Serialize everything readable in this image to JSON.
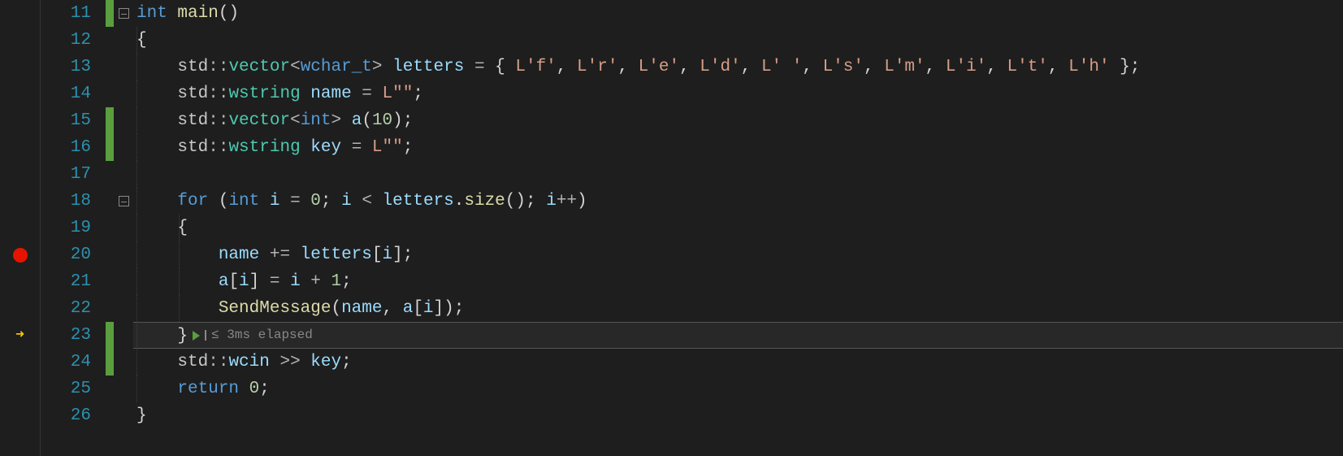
{
  "lines": [
    {
      "n": 11,
      "changed": true,
      "fold": true,
      "bp": false,
      "cur": false
    },
    {
      "n": 12,
      "changed": false,
      "fold": false,
      "bp": false,
      "cur": false
    },
    {
      "n": 13,
      "changed": false,
      "fold": false,
      "bp": false,
      "cur": false
    },
    {
      "n": 14,
      "changed": false,
      "fold": false,
      "bp": false,
      "cur": false
    },
    {
      "n": 15,
      "changed": true,
      "fold": false,
      "bp": false,
      "cur": false
    },
    {
      "n": 16,
      "changed": true,
      "fold": false,
      "bp": false,
      "cur": false
    },
    {
      "n": 17,
      "changed": false,
      "fold": false,
      "bp": false,
      "cur": false
    },
    {
      "n": 18,
      "changed": false,
      "fold": true,
      "bp": false,
      "cur": false
    },
    {
      "n": 19,
      "changed": false,
      "fold": false,
      "bp": false,
      "cur": false
    },
    {
      "n": 20,
      "changed": false,
      "fold": false,
      "bp": true,
      "cur": false
    },
    {
      "n": 21,
      "changed": false,
      "fold": false,
      "bp": false,
      "cur": false
    },
    {
      "n": 22,
      "changed": false,
      "fold": false,
      "bp": false,
      "cur": false
    },
    {
      "n": 23,
      "changed": true,
      "fold": false,
      "bp": false,
      "cur": true
    },
    {
      "n": 24,
      "changed": true,
      "fold": false,
      "bp": false,
      "cur": false
    },
    {
      "n": 25,
      "changed": false,
      "fold": false,
      "bp": false,
      "cur": false
    },
    {
      "n": 26,
      "changed": false,
      "fold": false,
      "bp": false,
      "cur": false
    }
  ],
  "code": {
    "l11": {
      "kw": "int",
      "fn": "main",
      "p": "()"
    },
    "l12": {
      "brace": "{"
    },
    "l13": {
      "ns": "std",
      "sc": "::",
      "cls": "vector",
      "lt": "<",
      "t": "wchar_t",
      "gt": ">",
      "var": "letters",
      "eq": " = ",
      "ob": "{ ",
      "c0": "L'f'",
      "s0": ", ",
      "c1": "L'r'",
      "s1": ", ",
      "c2": "L'e'",
      "s2": ", ",
      "c3": "L'd'",
      "s3": ", ",
      "c4": "L' '",
      "s4": ", ",
      "c5": "L's'",
      "s5": ", ",
      "c6": "L'm'",
      "s6": ", ",
      "c7": "L'i'",
      "s7": ", ",
      "c8": "L't'",
      "s8": ", ",
      "c9": "L'h'",
      "cb": " };"
    },
    "l14": {
      "ns": "std",
      "sc": "::",
      "cls": "wstring",
      "var": "name",
      "eq": " = ",
      "pfx": "L",
      "str": "\"\"",
      "semi": ";"
    },
    "l15": {
      "ns": "std",
      "sc": "::",
      "cls": "vector",
      "lt": "<",
      "t": "int",
      "gt": ">",
      "var": "a",
      "open": "(",
      "num": "10",
      "close": ");"
    },
    "l16": {
      "ns": "std",
      "sc": "::",
      "cls": "wstring",
      "var": "key",
      "eq": " = ",
      "pfx": "L",
      "str": "\"\"",
      "semi": ";"
    },
    "l18": {
      "kw": "for",
      "op": " (",
      "t": "int",
      "var": "i",
      "eq": " = ",
      "z": "0",
      "semi": "; ",
      "var2": "i",
      "lt": " < ",
      "obj": "letters",
      "dot": ".",
      "fn": "size",
      "par": "(); ",
      "var3": "i",
      "inc": "++",
      ")": ")"
    },
    "l19": {
      "brace": "{"
    },
    "l20": {
      "var": "name",
      "op": " += ",
      "arr": "letters",
      "ob": "[",
      "idx": "i",
      "cb": "];"
    },
    "l21": {
      "arr": "a",
      "ob": "[",
      "idx": "i",
      "cb": "]",
      "eq": " = ",
      "var": "i",
      "plus": " + ",
      "one": "1",
      "semi": ";"
    },
    "l22": {
      "fn": "SendMessage",
      "op": "(",
      "a1": "name",
      "c": ", ",
      "a2": "a",
      "ob": "[",
      "idx": "i",
      "cb": "]);"
    },
    "l23": {
      "brace": "}",
      "perf": "≤ 3ms elapsed"
    },
    "l24": {
      "ns": "std",
      "sc": "::",
      "obj": "wcin",
      "op": " >> ",
      "var": "key",
      "semi": ";"
    },
    "l25": {
      "kw": "return",
      "sp": " ",
      "z": "0",
      "semi": ";"
    },
    "l26": {
      "brace": "}"
    }
  }
}
